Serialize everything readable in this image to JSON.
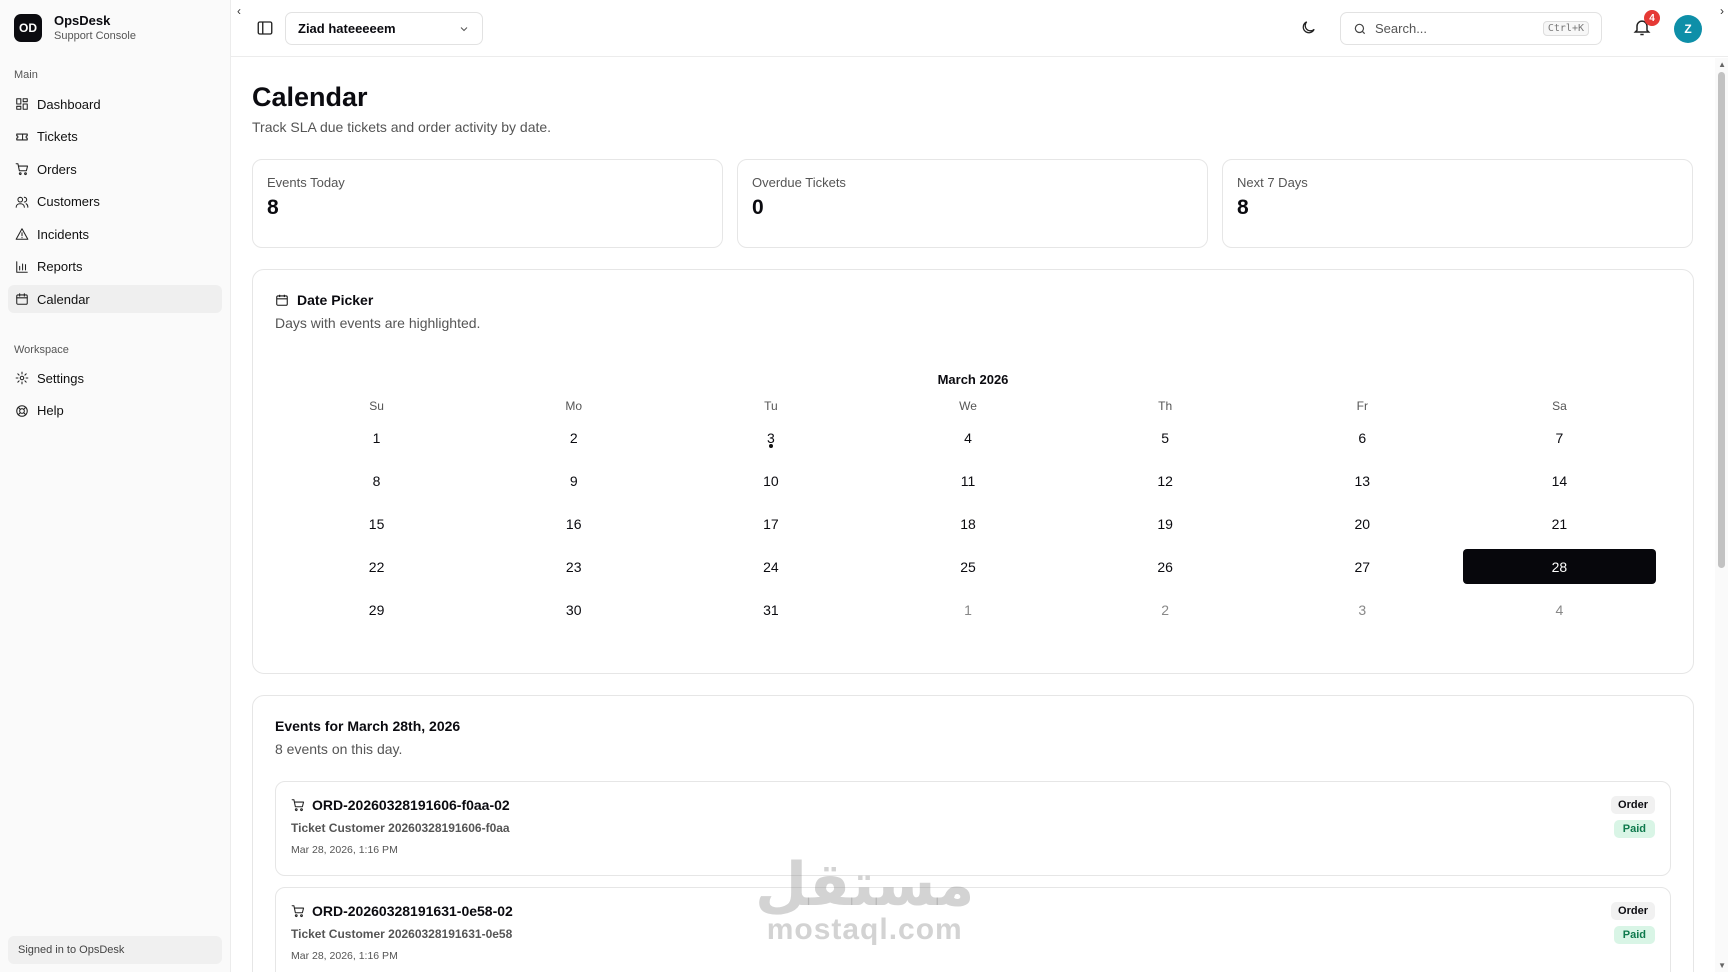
{
  "brand": {
    "logo": "OD",
    "name": "OpsDesk",
    "subtitle": "Support Console"
  },
  "sidebar": {
    "main_label": "Main",
    "main_items": [
      {
        "label": "Dashboard",
        "icon": "grid-icon"
      },
      {
        "label": "Tickets",
        "icon": "ticket-icon"
      },
      {
        "label": "Orders",
        "icon": "cart-icon"
      },
      {
        "label": "Customers",
        "icon": "users-icon"
      },
      {
        "label": "Incidents",
        "icon": "alert-icon"
      },
      {
        "label": "Reports",
        "icon": "bar-chart-icon"
      },
      {
        "label": "Calendar",
        "icon": "calendar-icon",
        "active": true
      }
    ],
    "workspace_label": "Workspace",
    "workspace_items": [
      {
        "label": "Settings",
        "icon": "gear-icon"
      },
      {
        "label": "Help",
        "icon": "help-icon"
      }
    ],
    "footer": "Signed in to OpsDesk"
  },
  "topbar": {
    "workspace": "Ziad hateeeeem",
    "search_placeholder": "Search...",
    "search_shortcut": "Ctrl+K",
    "notification_count": "4",
    "avatar_initial": "Z"
  },
  "page": {
    "title": "Calendar",
    "subtitle": "Track SLA due tickets and order activity by date."
  },
  "stats": [
    {
      "label": "Events Today",
      "value": "8"
    },
    {
      "label": "Overdue Tickets",
      "value": "0"
    },
    {
      "label": "Next 7 Days",
      "value": "8"
    }
  ],
  "date_picker": {
    "title": "Date Picker",
    "subtitle": "Days with events are highlighted.",
    "month": "March 2026",
    "weekdays": [
      "Su",
      "Mo",
      "Tu",
      "We",
      "Th",
      "Fr",
      "Sa"
    ],
    "weeks": [
      [
        {
          "d": "1"
        },
        {
          "d": "2"
        },
        {
          "d": "3",
          "dot": true
        },
        {
          "d": "4"
        },
        {
          "d": "5"
        },
        {
          "d": "6"
        },
        {
          "d": "7"
        }
      ],
      [
        {
          "d": "8"
        },
        {
          "d": "9"
        },
        {
          "d": "10"
        },
        {
          "d": "11"
        },
        {
          "d": "12"
        },
        {
          "d": "13"
        },
        {
          "d": "14"
        }
      ],
      [
        {
          "d": "15"
        },
        {
          "d": "16"
        },
        {
          "d": "17"
        },
        {
          "d": "18"
        },
        {
          "d": "19"
        },
        {
          "d": "20"
        },
        {
          "d": "21"
        }
      ],
      [
        {
          "d": "22"
        },
        {
          "d": "23"
        },
        {
          "d": "24"
        },
        {
          "d": "25"
        },
        {
          "d": "26"
        },
        {
          "d": "27"
        },
        {
          "d": "28",
          "selected": true
        }
      ],
      [
        {
          "d": "29"
        },
        {
          "d": "30"
        },
        {
          "d": "31"
        },
        {
          "d": "1",
          "muted": true
        },
        {
          "d": "2",
          "muted": true
        },
        {
          "d": "3",
          "muted": true
        },
        {
          "d": "4",
          "muted": true
        }
      ]
    ]
  },
  "events": {
    "title": "Events for March 28th, 2026",
    "subtitle": "8 events on this day.",
    "items": [
      {
        "title": "ORD-20260328191606-f0aa-02",
        "customer": "Ticket Customer 20260328191606-f0aa",
        "date": "Mar 28, 2026, 1:16 PM",
        "type": "Order",
        "status": "Paid"
      },
      {
        "title": "ORD-20260328191631-0e58-02",
        "customer": "Ticket Customer 20260328191631-0e58",
        "date": "Mar 28, 2026, 1:16 PM",
        "type": "Order",
        "status": "Paid"
      }
    ]
  },
  "watermark": {
    "arabic": "مستقل",
    "latin": "mostaql.com"
  }
}
